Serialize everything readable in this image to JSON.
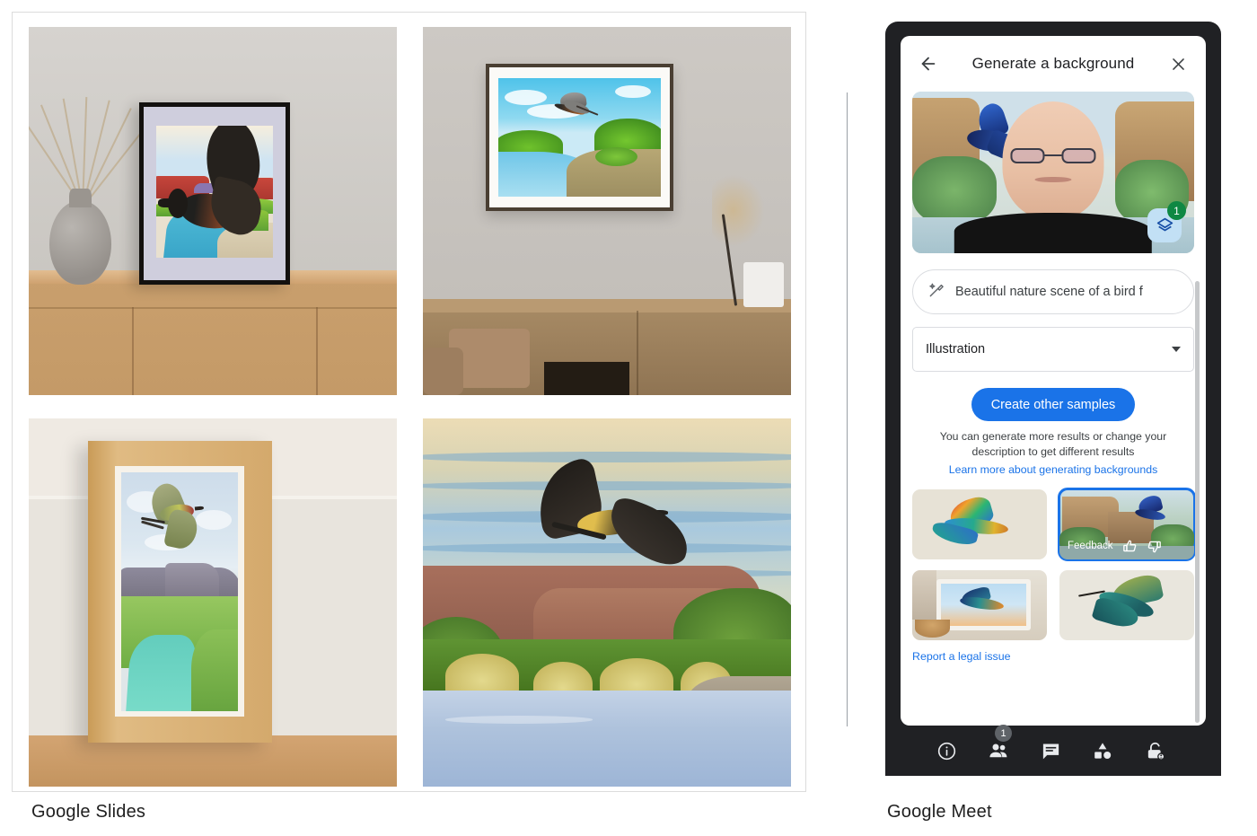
{
  "captions": {
    "slides": "Google Slides",
    "meet": "Google Meet"
  },
  "slides": {
    "artworks": [
      {
        "title": "Framed canyon watercolor on sideboard with vase",
        "frame": "black"
      },
      {
        "title": "Framed river landscape hung above bench",
        "frame": "dark wood"
      },
      {
        "title": "Light wood framed desert river painting leaning on floor",
        "frame": "light oak"
      },
      {
        "title": "Full-bleed painting of bird over canyon river",
        "frame": "none"
      }
    ]
  },
  "meet": {
    "header": {
      "back_icon": "arrow-back-icon",
      "title": "Generate a background",
      "close_icon": "close-icon"
    },
    "preview": {
      "badge_count": "1",
      "layers_icon": "layers-icon"
    },
    "prompt": {
      "icon": "magic-wand-icon",
      "value": "Beautiful nature scene of a bird f"
    },
    "style": {
      "value": "Illustration",
      "caret_icon": "chevron-down-icon"
    },
    "cta": {
      "label": "Create other samples"
    },
    "helper": {
      "text": "You can generate more results or change your description to get different results",
      "link": "Learn more about generating backgrounds"
    },
    "thumbnails": [
      {
        "name": "rainbow-bird-sample",
        "selected": false,
        "feedback_label": ""
      },
      {
        "name": "canyon-bluebird-sample",
        "selected": true,
        "feedback_label": "Feedback"
      },
      {
        "name": "painting-on-tablet-sample",
        "selected": false,
        "feedback_label": ""
      },
      {
        "name": "teal-hummingbird-sample",
        "selected": false,
        "feedback_label": ""
      }
    ],
    "feedback": {
      "label": "Feedback",
      "thumb_up_icon": "thumb-up-icon",
      "thumb_down_icon": "thumb-down-icon"
    },
    "legal_link": "Report a legal issue",
    "toolbar": {
      "items": [
        {
          "name": "meeting-details-icon",
          "label": "info-icon",
          "badge": ""
        },
        {
          "name": "people-icon",
          "label": "people-icon",
          "badge": "1"
        },
        {
          "name": "chat-icon",
          "label": "chat-icon",
          "badge": ""
        },
        {
          "name": "activities-icon",
          "label": "activities-icon",
          "badge": ""
        },
        {
          "name": "host-controls-icon",
          "label": "lock-icon",
          "badge": ""
        }
      ]
    }
  },
  "colors": {
    "accent_blue": "#1a73e8",
    "badge_green": "#0f8843",
    "meet_dark": "#202124",
    "text_primary": "#202124",
    "border_gray": "#dadce0"
  }
}
